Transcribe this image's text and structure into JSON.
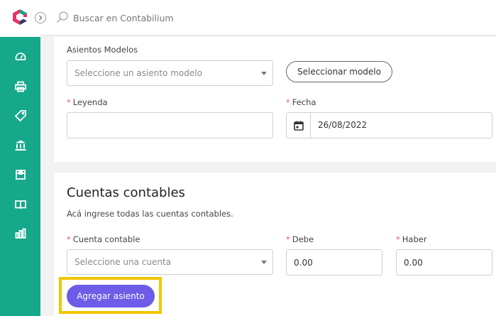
{
  "app": {
    "logo_icon": "contabilium-logo-icon",
    "brand_colors": {
      "primary": "#15a88a",
      "accent": "#6c5ce7",
      "highlight": "#f2c500",
      "required": "#e25c5c"
    }
  },
  "topbar": {
    "search_placeholder": "Buscar en Contabilium",
    "search_icon": "search-icon",
    "collapse_icon": "chevron-right-icon"
  },
  "sidebar": {
    "items": [
      {
        "icon": "dashboard-icon"
      },
      {
        "icon": "printer-icon"
      },
      {
        "icon": "tag-icon"
      },
      {
        "icon": "bank-icon"
      },
      {
        "icon": "box-icon"
      },
      {
        "icon": "book-icon"
      },
      {
        "icon": "bar-chart-icon"
      }
    ]
  },
  "asiento": {
    "modelos_label": "Asientos Modelos",
    "modelos_placeholder": "Seleccione un asiento modelo",
    "seleccionar_button": "Seleccionar modelo",
    "leyenda_label": "Leyenda",
    "leyenda_value": "",
    "fecha_label": "Fecha",
    "fecha_value": "26/08/2022",
    "required_mark": "*"
  },
  "cuentas": {
    "title": "Cuentas contables",
    "description": "Acá ingrese todas las cuentas contables.",
    "cuenta_label": "Cuenta contable",
    "cuenta_placeholder": "Seleccione una cuenta",
    "debe_label": "Debe",
    "debe_value": "0.00",
    "haber_label": "Haber",
    "haber_value": "0.00",
    "agregar_button": "Agregar asiento"
  }
}
